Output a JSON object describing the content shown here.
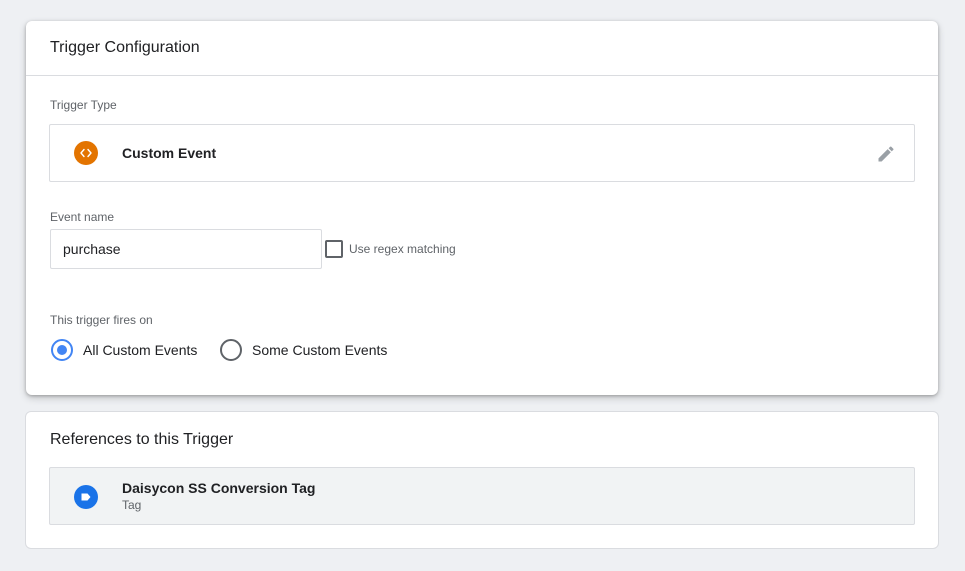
{
  "config": {
    "title": "Trigger Configuration",
    "trigger_type_label": "Trigger Type",
    "trigger_type": {
      "name": "Custom Event",
      "icon": "code-brackets-icon",
      "icon_color": "#e37400"
    },
    "event_name_label": "Event name",
    "event_name_value": "purchase",
    "regex_label": "Use regex matching",
    "regex_checked": false,
    "fires_on_label": "This trigger fires on",
    "fires_on_options": [
      {
        "label": "All Custom Events",
        "selected": true
      },
      {
        "label": "Some Custom Events",
        "selected": false
      }
    ]
  },
  "references": {
    "title": "References to this Trigger",
    "items": [
      {
        "name": "Daisycon SS Conversion Tag",
        "type": "Tag",
        "icon": "tag-icon",
        "icon_color": "#1a73e8"
      }
    ]
  },
  "colors": {
    "accent": "#4285f4",
    "background": "#eef0f3"
  }
}
